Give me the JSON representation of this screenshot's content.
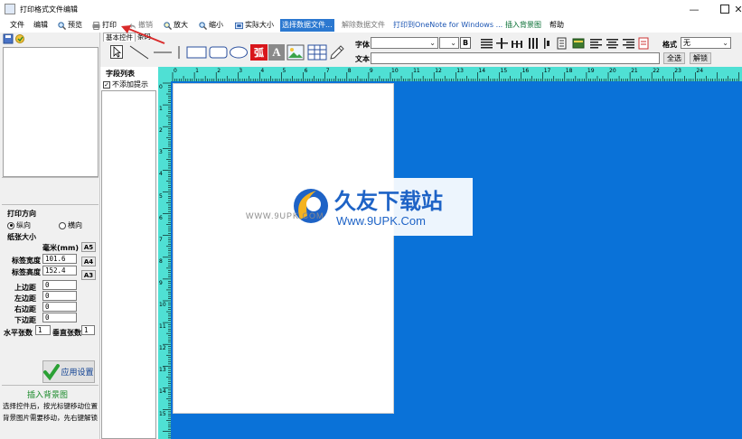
{
  "window": {
    "title": "打印格式文件编辑",
    "controls": {
      "minimize": "—",
      "maximize": "☐",
      "close": "✕"
    }
  },
  "menu": {
    "file": "文件",
    "edit": "编辑",
    "preview": "预览",
    "print": "打印",
    "undo": "撤销",
    "zoom_in": "放大",
    "zoom_out": "缩小",
    "actual_size": "实际大小",
    "select_data_file": "选择数据文件...",
    "unbind_data_file": "解除数据文件",
    "print_to_onenote": "打印到OneNote for Windows ...",
    "insert_background": "插入背景图",
    "help": "帮助"
  },
  "toolbar": {
    "basic_tools_tab": "基本控件",
    "tab2_label": "条码",
    "font_label": "字体",
    "font_value": "",
    "bold": "B",
    "format_label": "格式",
    "format_value": "无",
    "text_label": "文本",
    "text_value": "",
    "select_all": "全选",
    "unlock": "解锁",
    "arc_tool": "弧",
    "text_tool": "A"
  },
  "field_list": {
    "title": "字段列表",
    "no_prompt_label": "不添加提示",
    "no_prompt_checked": true
  },
  "print_settings": {
    "direction_title": "打印方向",
    "portrait": "纵向",
    "landscape": "横向",
    "portrait_selected": true,
    "paper_size_title": "纸张大小",
    "unit": "毫米(mm)",
    "label_width_label": "标签宽度",
    "label_width": "101.6",
    "label_height_label": "标签高度",
    "label_height": "152.4",
    "size_a5": "A5",
    "size_a4": "A4",
    "size_a3": "A3",
    "margin_top_label": "上边距",
    "margin_top": "0",
    "margin_left_label": "左边距",
    "margin_left": "0",
    "margin_right_label": "右边距",
    "margin_right": "0",
    "margin_bottom_label": "下边距",
    "margin_bottom": "0",
    "h_count_label": "水平张数",
    "h_count": "1",
    "v_count_label": "垂直张数",
    "v_count": "1",
    "apply_button": "应用设置",
    "insert_bg_title": "插入背景图",
    "hint_line1": "选择控件后，按光标键移动位置",
    "hint_line2": "背景图片需要移动，先右键解锁"
  },
  "ruler": {
    "h_labels": [
      "0",
      "1",
      "2",
      "3",
      "4",
      "5",
      "6",
      "7",
      "8",
      "9",
      "10",
      "11",
      "12",
      "13",
      "14",
      "15",
      "16",
      "17",
      "18",
      "19",
      "20",
      "21",
      "22",
      "23",
      "24"
    ],
    "v_labels": [
      "0",
      "1",
      "2",
      "3",
      "4",
      "5",
      "6",
      "7",
      "8",
      "9",
      "10",
      "11",
      "12",
      "13",
      "14",
      "15"
    ]
  },
  "watermark": {
    "brand": "久友下载站",
    "url": "Www.9UPK.Com",
    "faint_url": "WWW.9UPK.COM"
  },
  "colors": {
    "canvas_bg": "#0a72d8",
    "ruler_bg": "#4fe0d4",
    "menu_highlight": "#2b78d0",
    "arc_tool_red": "#d8161b",
    "apply_green": "#2aa034"
  }
}
